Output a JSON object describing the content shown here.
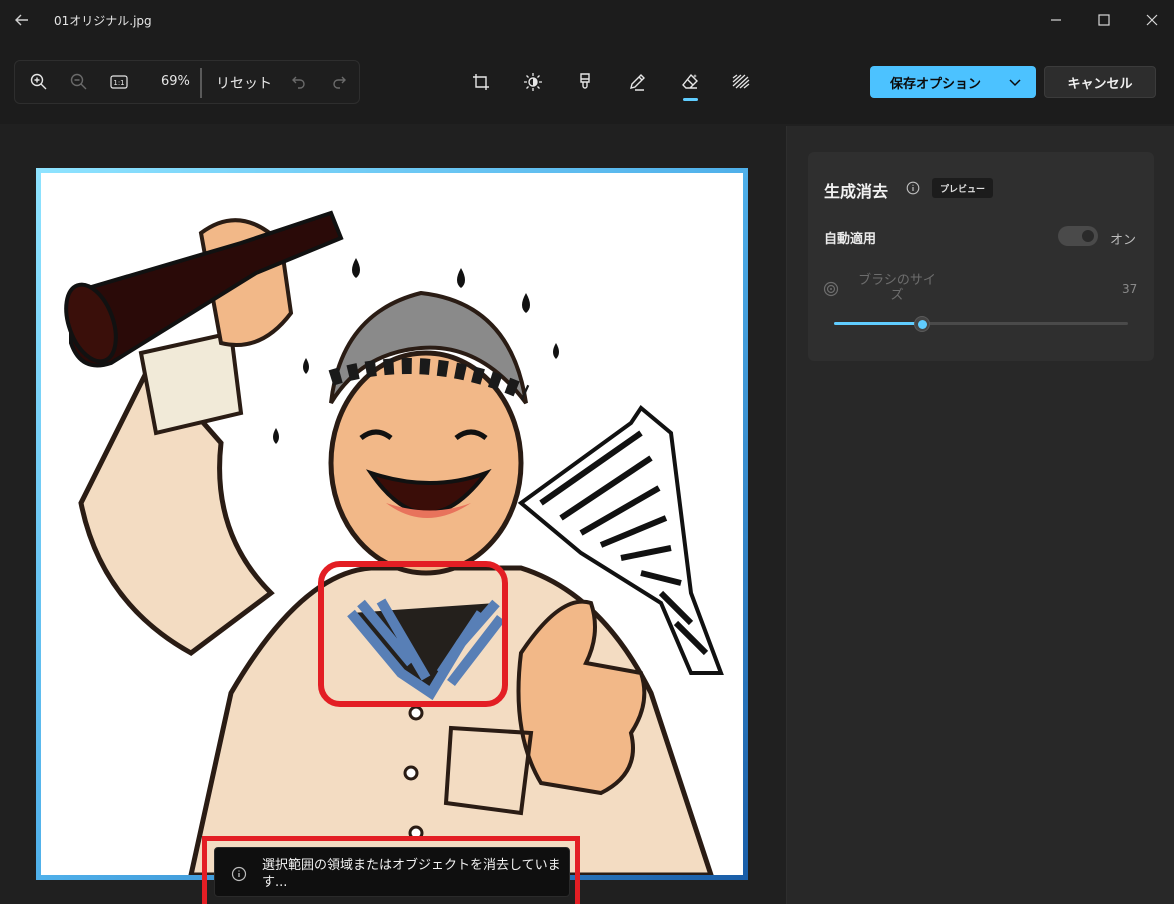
{
  "window": {
    "title": "01オリジナル.jpg"
  },
  "toolbar": {
    "zoom_level": "69%",
    "actual_size_label": "1:1",
    "reset_label": "リセット",
    "save_label": "保存オプション",
    "cancel_label": "キャンセル",
    "active_tool": "erase-tool"
  },
  "editor": {
    "selection_fraction_of_canvas": 0.27
  },
  "toast": {
    "message": "選択範囲の領域またはオブジェクトを消去しています..."
  },
  "panel": {
    "title": "生成消去",
    "badge": "プレビュー",
    "auto_apply_label": "自動適用",
    "auto_apply_state": "オン",
    "brush_size_label": "ブラシのサイズ",
    "brush_size_value": "37",
    "brush_size_fraction": 0.3
  },
  "colors": {
    "accent": "#4cc2ff",
    "highlight": "#e31e24",
    "background": "#202020"
  }
}
